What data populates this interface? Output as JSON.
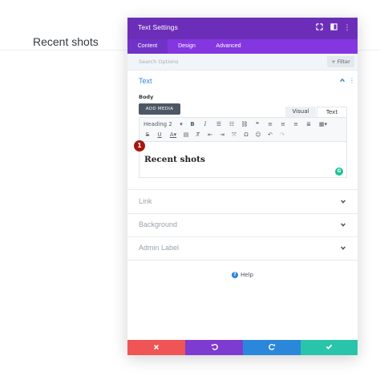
{
  "page": {
    "heading": "Recent shots"
  },
  "modal": {
    "title": "Text Settings",
    "header_icons": [
      "expand-icon",
      "split-view-icon",
      "more-vertical-icon"
    ],
    "tabs": [
      {
        "label": "Content",
        "active": true
      },
      {
        "label": "Design",
        "active": false
      },
      {
        "label": "Advanced",
        "active": false
      }
    ],
    "search": {
      "placeholder": "Search Options",
      "filter_label": "+ Filter"
    },
    "text_section": {
      "title": "Text",
      "body_label": "Body",
      "add_media_label": "ADD MEDIA",
      "editor_tabs": {
        "visual": "Visual",
        "text": "Text"
      },
      "format_select": "Heading 2",
      "editor_content": "Recent shots",
      "badge": "1",
      "grammarly": "G"
    },
    "sections": [
      {
        "title": "Link"
      },
      {
        "title": "Background"
      },
      {
        "title": "Admin Label"
      }
    ],
    "help_label": "Help",
    "colors": {
      "header": "#6c2eb9",
      "tabs": "#8436e0",
      "accent": "#2b87da",
      "cancel": "#ef5555",
      "undo": "#7e3bd0",
      "redo": "#2b87da",
      "save": "#29c4a9"
    }
  }
}
